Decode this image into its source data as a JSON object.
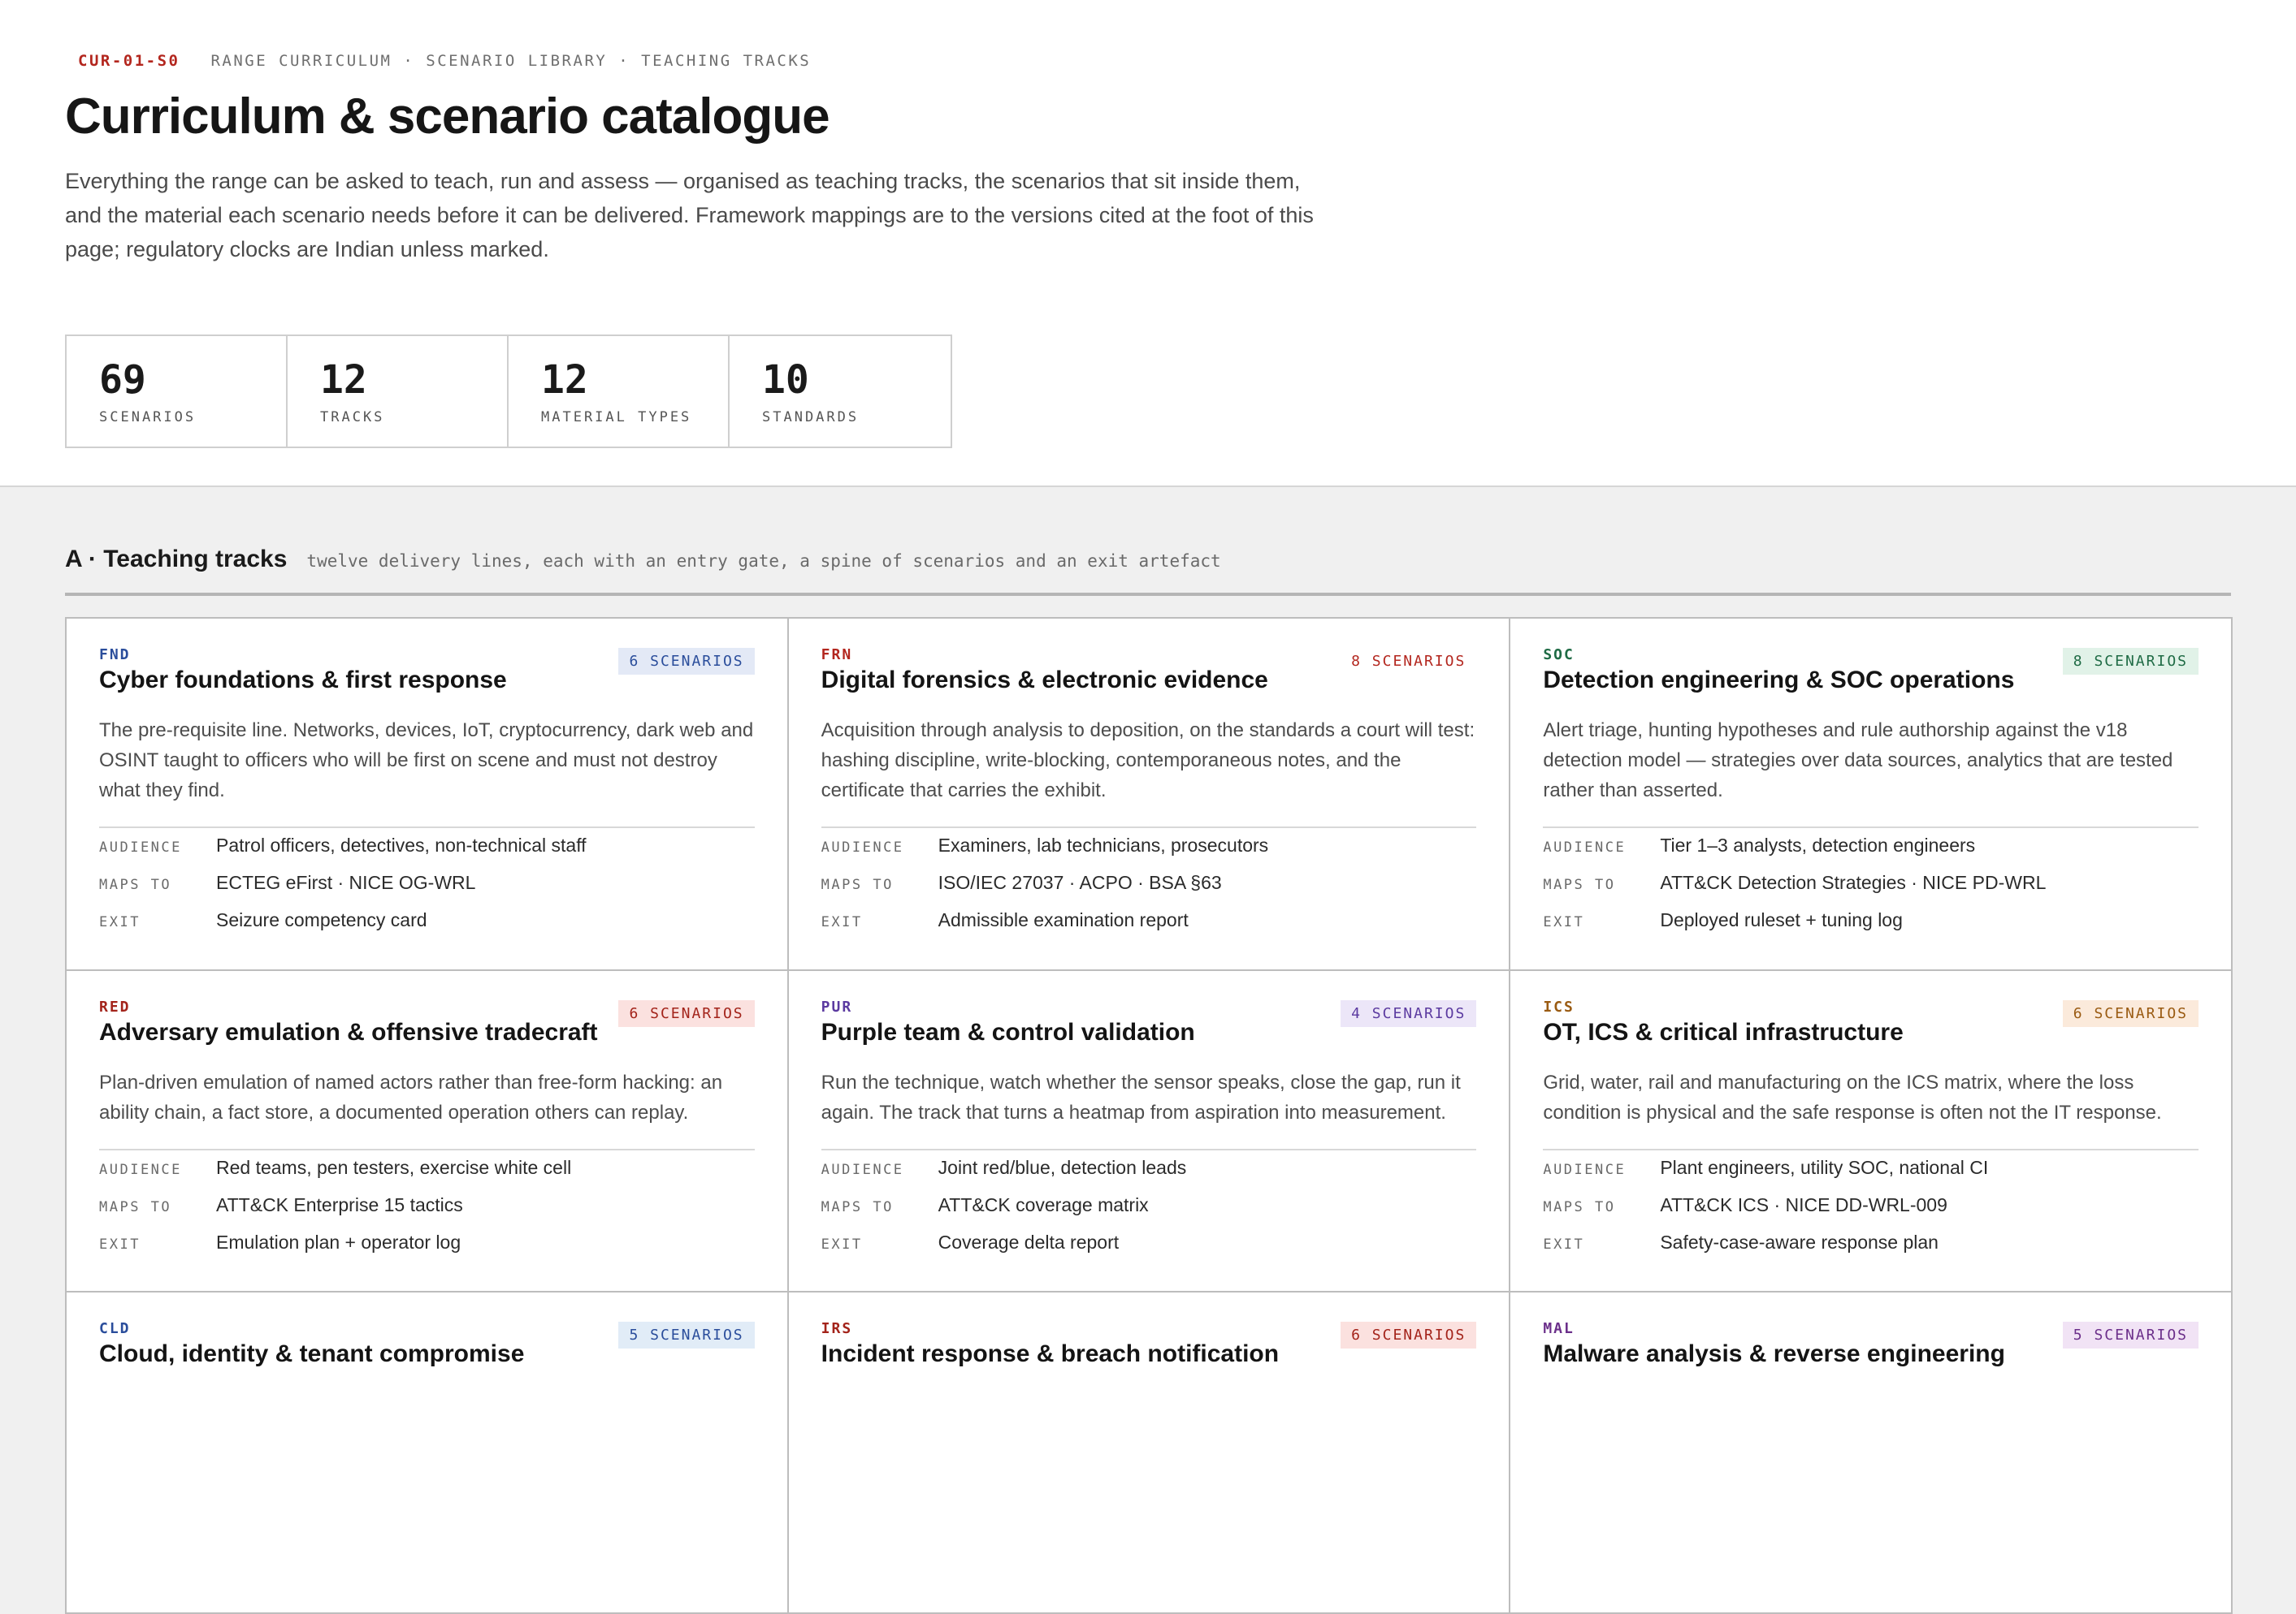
{
  "header": {
    "code": "CUR-01-S0",
    "breadcrumb": "RANGE CURRICULUM · SCENARIO LIBRARY · TEACHING TRACKS",
    "title": "Curriculum & scenario catalogue",
    "lede": "Everything the range can be asked to teach, run and assess — organised as teaching tracks, the scenarios that sit inside them, and the material each scenario needs before it can be delivered. Framework mappings are to the versions cited at the foot of this page; regulatory clocks are Indian unless marked."
  },
  "stats": [
    {
      "num": "69",
      "label": "SCENARIOS"
    },
    {
      "num": "12",
      "label": "TRACKS"
    },
    {
      "num": "12",
      "label": "MATERIAL TYPES"
    },
    {
      "num": "10",
      "label": "STANDARDS"
    }
  ],
  "section": {
    "heading": "A · Teaching tracks",
    "sub": "twelve delivery lines, each with an entry gate, a spine of scenarios and an exit artefact"
  },
  "meta_labels": {
    "audience": "AUDIENCE",
    "maps_to": "MAPS TO",
    "exit": "EXIT"
  },
  "tracks": [
    {
      "tag": "FND",
      "badge": "6 SCENARIOS",
      "title": "Cyber foundations & first response",
      "desc": "The pre-requisite line. Networks, devices, IoT, cryptocurrency, dark web and OSINT taught to officers who will be first on scene and must not destroy what they find.",
      "audience": "Patrol officers, detectives, non-technical staff",
      "maps_to": "ECTEG eFirst · NICE OG-WRL",
      "exit": "Seizure competency card",
      "tag_color": "#2a4d9b",
      "badge_color": "#2a4d9b",
      "badge_bg": "#e3e9f6"
    },
    {
      "tag": "FRN",
      "badge": "8 SCENARIOS",
      "title": "Digital forensics & electronic evidence",
      "desc": "Acquisition through analysis to deposition, on the standards a court will test: hashing discipline, write-blocking, contemporaneous notes, and the certificate that carries the exhibit.",
      "audience": "Examiners, lab technicians, prosecutors",
      "maps_to": "ISO/IEC 27037 · ACPO · BSA §63",
      "exit": "Admissible examination report",
      "tag_color": "#b3261e",
      "badge_color": "#b3261e",
      "badge_bg": "#ffffff"
    },
    {
      "tag": "SOC",
      "badge": "8 SCENARIOS",
      "title": "Detection engineering & SOC operations",
      "desc": "Alert triage, hunting hypotheses and rule authorship against the v18 detection model — strategies over data sources, analytics that are tested rather than asserted.",
      "audience": "Tier 1–3 analysts, detection engineers",
      "maps_to": "ATT&CK Detection Strategies · NICE PD-WRL",
      "exit": "Deployed ruleset + tuning log",
      "tag_color": "#1f6b45",
      "badge_color": "#1f6b45",
      "badge_bg": "#e1f2e8"
    },
    {
      "tag": "RED",
      "badge": "6 SCENARIOS",
      "title": "Adversary emulation & offensive tradecraft",
      "desc": "Plan-driven emulation of named actors rather than free-form hacking: an ability chain, a fact store, a documented operation others can replay.",
      "audience": "Red teams, pen testers, exercise white cell",
      "maps_to": "ATT&CK Enterprise 15 tactics",
      "exit": "Emulation plan + operator log",
      "tag_color": "#a3231a",
      "badge_color": "#a3231a",
      "badge_bg": "#fbe1df"
    },
    {
      "tag": "PUR",
      "badge": "4 SCENARIOS",
      "title": "Purple team & control validation",
      "desc": "Run the technique, watch whether the sensor speaks, close the gap, run it again. The track that turns a heatmap from aspiration into measurement.",
      "audience": "Joint red/blue, detection leads",
      "maps_to": "ATT&CK coverage matrix",
      "exit": "Coverage delta report",
      "tag_color": "#5b3aa0",
      "badge_color": "#5b3aa0",
      "badge_bg": "#ece6f8"
    },
    {
      "tag": "ICS",
      "badge": "6 SCENARIOS",
      "title": "OT, ICS & critical infrastructure",
      "desc": "Grid, water, rail and manufacturing on the ICS matrix, where the loss condition is physical and the safe response is often not the IT response.",
      "audience": "Plant engineers, utility SOC, national CI",
      "maps_to": "ATT&CK ICS · NICE DD-WRL-009",
      "exit": "Safety-case-aware response plan",
      "tag_color": "#9a5b12",
      "badge_color": "#9a5b12",
      "badge_bg": "#fbeadb"
    },
    {
      "tag": "CLD",
      "badge": "5 SCENARIOS",
      "title": "Cloud, identity & tenant compromise",
      "desc": "",
      "audience": "",
      "maps_to": "",
      "exit": "",
      "tag_color": "#2a4d9b",
      "badge_color": "#2a4d9b",
      "badge_bg": "#e1ecf7"
    },
    {
      "tag": "IRS",
      "badge": "6 SCENARIOS",
      "title": "Incident response & breach notification",
      "desc": "",
      "audience": "",
      "maps_to": "",
      "exit": "",
      "tag_color": "#a3231a",
      "badge_color": "#a3231a",
      "badge_bg": "#fbe1df"
    },
    {
      "tag": "MAL",
      "badge": "5 SCENARIOS",
      "title": "Malware analysis & reverse engineering",
      "desc": "",
      "audience": "",
      "maps_to": "",
      "exit": "",
      "tag_color": "#6b2f8a",
      "badge_color": "#6b2f8a",
      "badge_bg": "#f1e3f5"
    }
  ]
}
